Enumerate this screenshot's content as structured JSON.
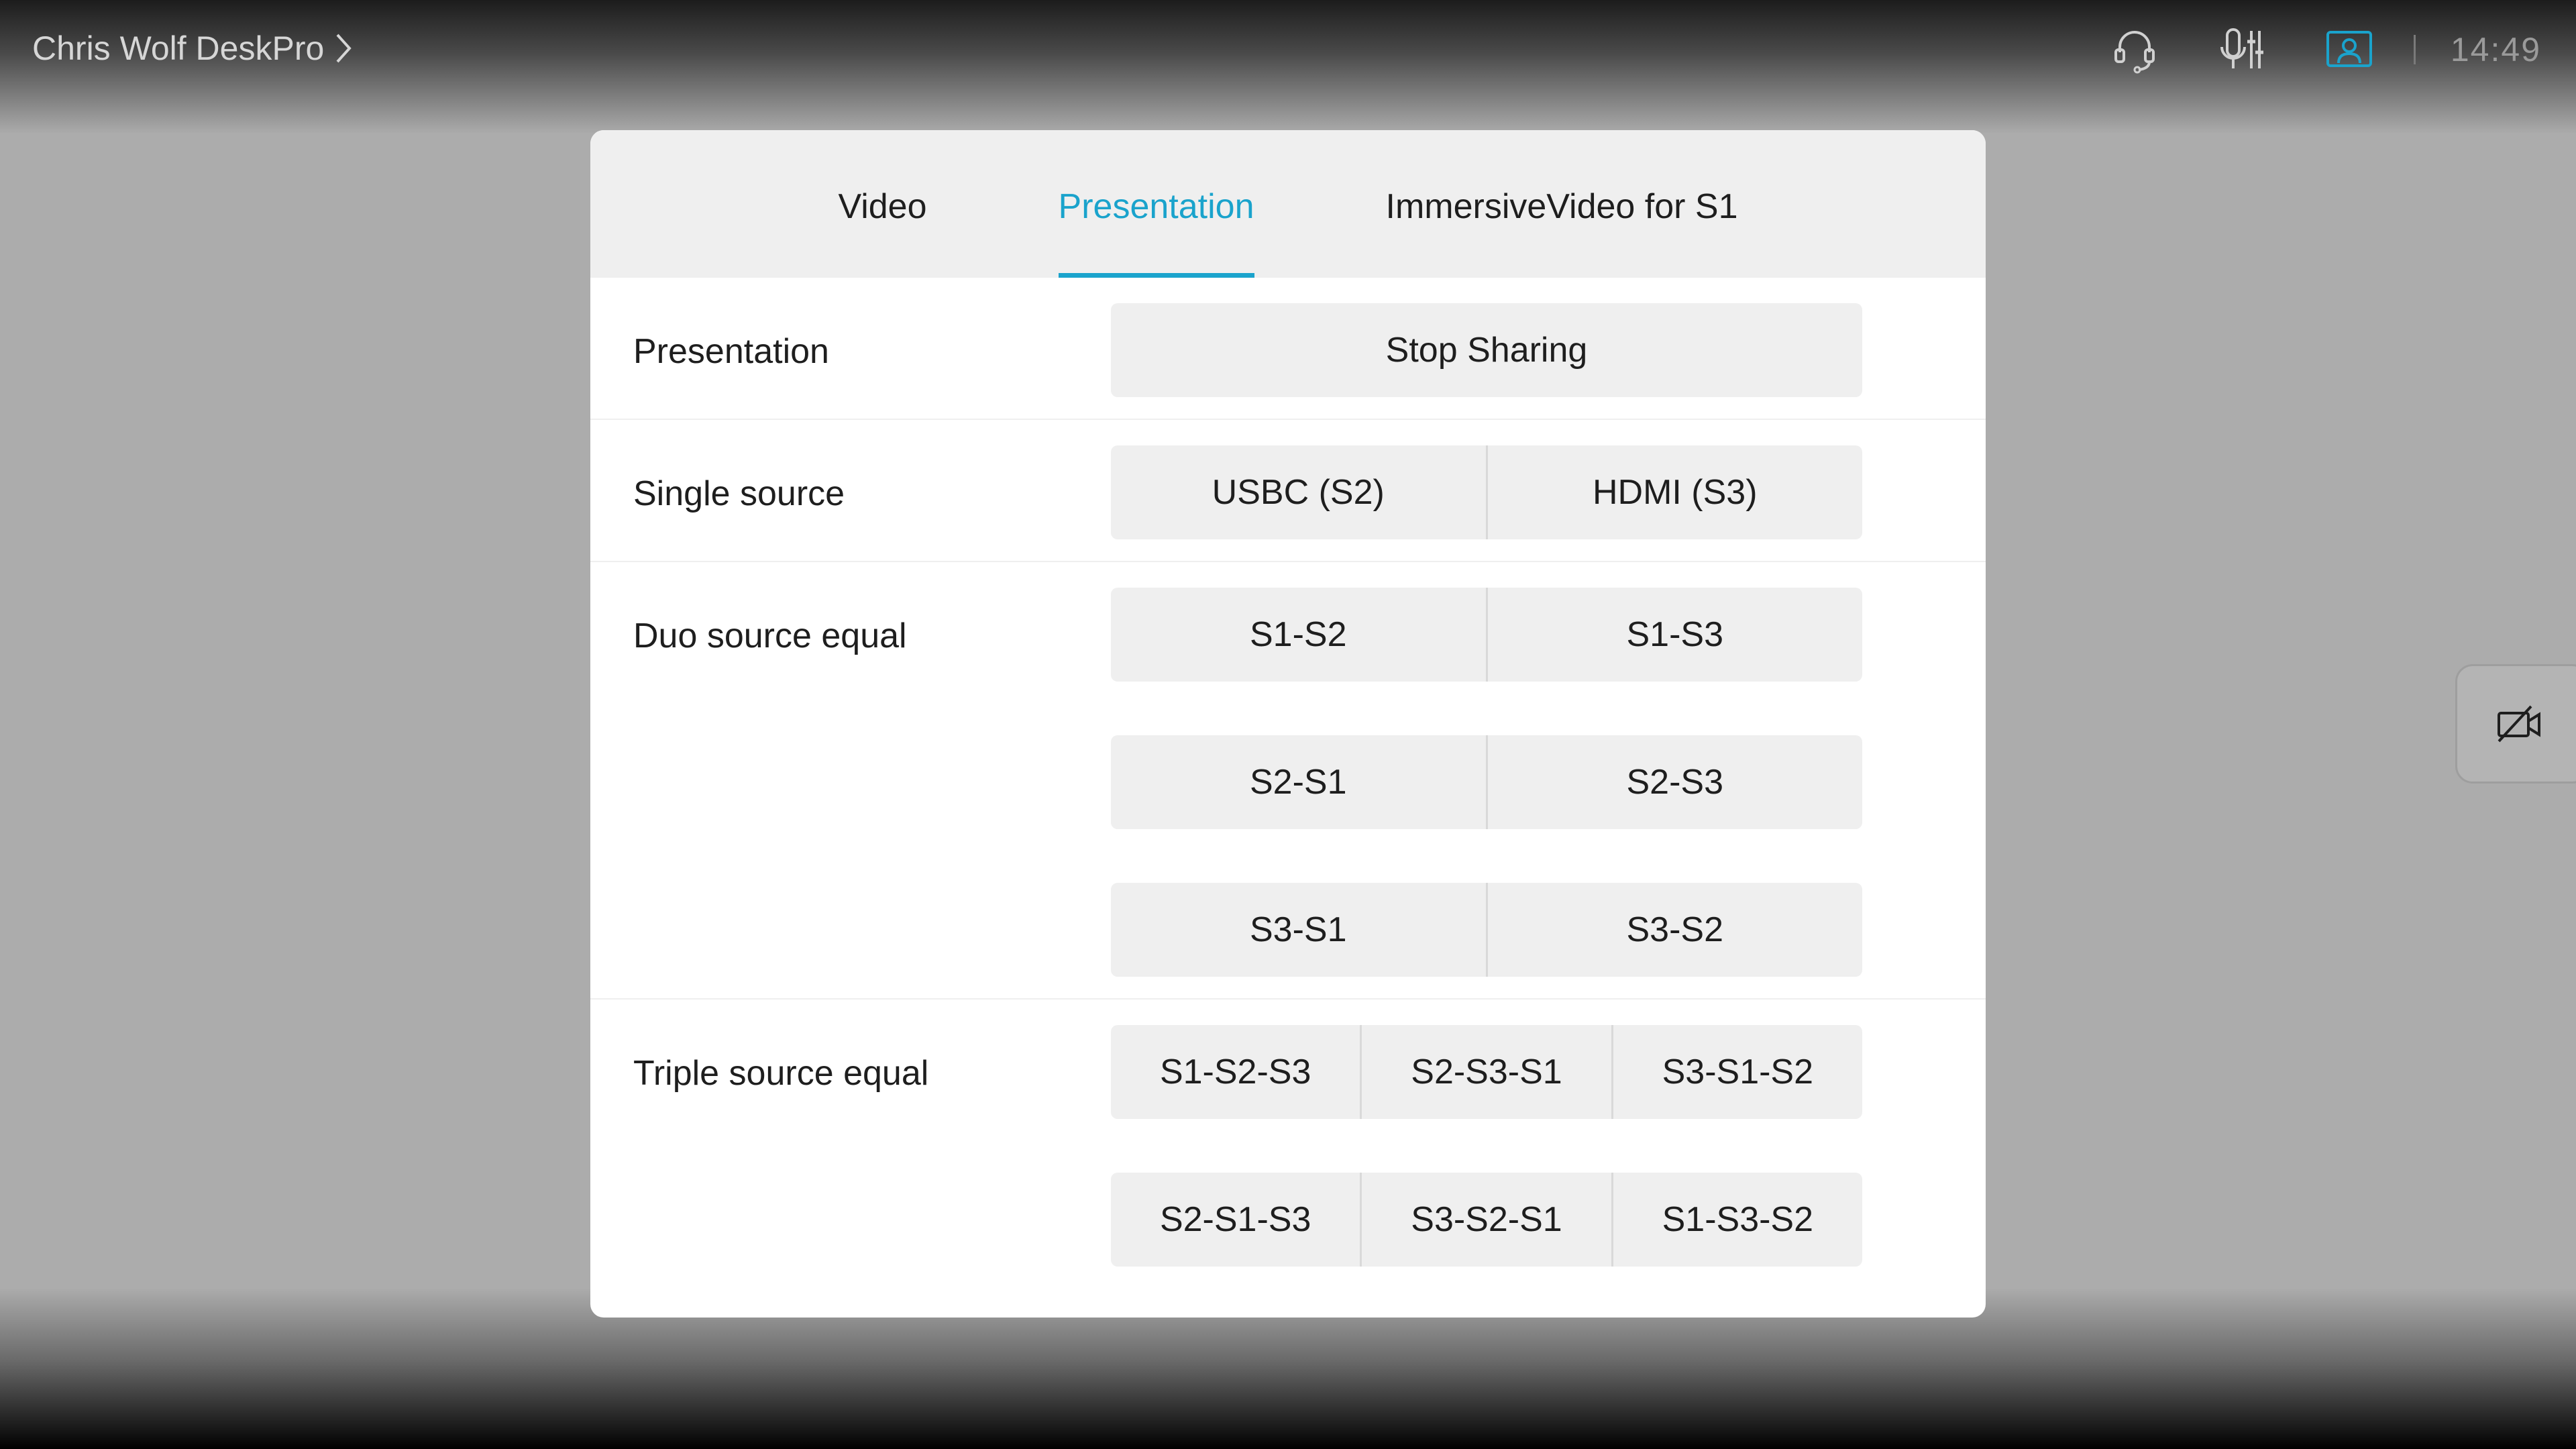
{
  "header": {
    "device_name": "Chris Wolf DeskPro",
    "clock": "14:49",
    "icons": [
      "headset-icon",
      "mic-settings-icon",
      "self-view-icon"
    ],
    "accent_color": "#1aa3cc"
  },
  "side_tab": {
    "icon": "camera-off-icon"
  },
  "dialog": {
    "tabs": [
      {
        "label": "Video",
        "active": false
      },
      {
        "label": "Presentation",
        "active": true
      },
      {
        "label": "ImmersiveVideo for S1",
        "active": false
      }
    ],
    "rows": [
      {
        "label": "Presentation",
        "buttons": [
          [
            "Stop Sharing"
          ]
        ]
      },
      {
        "label": "Single source",
        "buttons": [
          [
            "USBC (S2)",
            "HDMI (S3)"
          ]
        ]
      },
      {
        "label": "Duo source equal",
        "buttons": [
          [
            "S1-S2",
            "S1-S3"
          ],
          [
            "S2-S1",
            "S2-S3"
          ],
          [
            "S3-S1",
            "S3-S2"
          ]
        ]
      },
      {
        "label": "Triple source equal",
        "buttons": [
          [
            "S1-S2-S3",
            "S2-S3-S1",
            "S3-S1-S2"
          ],
          [
            "S2-S1-S3",
            "S3-S2-S1",
            "S1-S3-S2"
          ]
        ]
      }
    ]
  }
}
